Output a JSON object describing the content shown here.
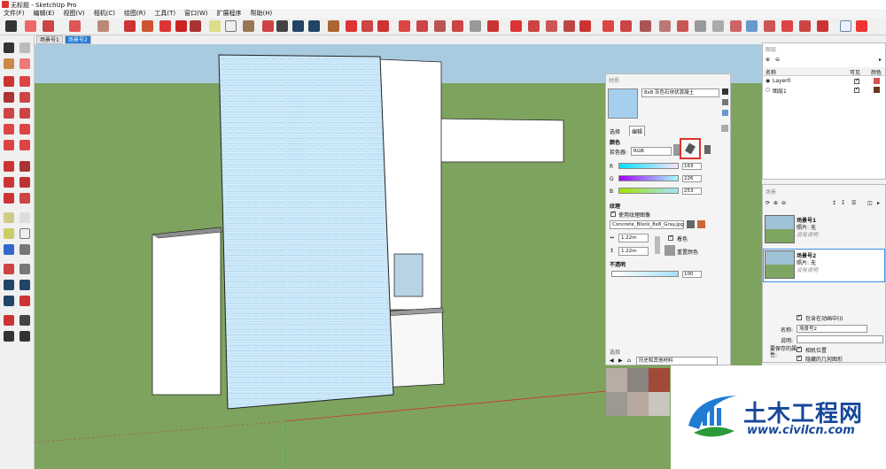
{
  "window": {
    "title": "无标题 - SketchUp Pro"
  },
  "menu": [
    "文件(F)",
    "编辑(E)",
    "视图(V)",
    "相机(C)",
    "绘图(R)",
    "工具(T)",
    "窗口(W)",
    "扩展程序",
    "帮助(H)"
  ],
  "scene_tabs": [
    "场景号1",
    "场景号2"
  ],
  "materials": {
    "header": "材质",
    "name": "8x8 灰色石块状混凝土",
    "tab_select": "选择",
    "tab_edit": "编辑",
    "color_label": "颜色",
    "picker_label": "拾色器:",
    "picker_value": "RGB",
    "r_label": "R",
    "r_value": "163",
    "g_label": "G",
    "g_value": "226",
    "b_label": "B",
    "b_value": "253",
    "texture_label": "纹理",
    "use_texture": "使用纹理图像",
    "texture_file": "Concrete_Block_8x8_Gray.jpg",
    "width": "1.22m",
    "height": "1.22m",
    "colorize": "着色",
    "reset_color": "重置颜色",
    "opacity_label": "不透明",
    "opacity_value": "100",
    "select_header": "选择",
    "library": "历史和其他材料"
  },
  "layers": {
    "header": "图层",
    "col_name": "名称",
    "col_visible": "可见",
    "col_color": "颜色",
    "rows": [
      {
        "name": "Layer0",
        "color": "#d9534f"
      },
      {
        "name": "图层1",
        "color": "#6b3a1f"
      }
    ]
  },
  "scenes": {
    "header": "场景",
    "items": [
      {
        "name": "场景号1",
        "photo": "照片: 无",
        "desc": "没有说明"
      },
      {
        "name": "场景号2",
        "photo": "照片: 无",
        "desc": "没有说明"
      }
    ],
    "include_anim": "包含在动画中(I)",
    "name_label": "名称:",
    "name_value": "场景号2",
    "desc_label": "说明:",
    "props_label": "要保存的属性:",
    "camera_pos": "相机位置",
    "hidden_geom": "隐藏的几何图形"
  },
  "watermark": {
    "brand": "土木工程网",
    "url": "www.civilcn.com"
  },
  "colors": {
    "sky": "#a9cbe0",
    "ground": "#7ea35f",
    "wall": "#ffffff",
    "texture": "#a5d3f0",
    "highlight": "#e0322a"
  }
}
